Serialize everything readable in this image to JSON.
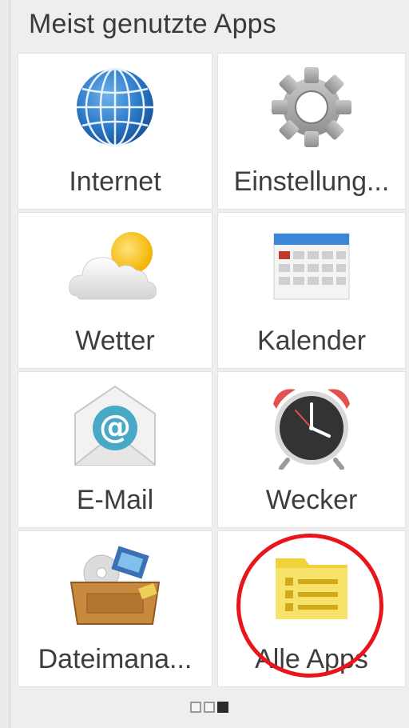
{
  "header": {
    "title": "Meist genutzte Apps"
  },
  "apps": [
    {
      "label": "Internet",
      "icon": "globe-icon"
    },
    {
      "label": "Einstellung...",
      "icon": "gear-icon"
    },
    {
      "label": "Wetter",
      "icon": "weather-cloud-sun-icon"
    },
    {
      "label": "Kalender",
      "icon": "calendar-icon"
    },
    {
      "label": "E-Mail",
      "icon": "email-envelope-icon"
    },
    {
      "label": "Wecker",
      "icon": "alarm-clock-icon"
    },
    {
      "label": "Dateimana...",
      "icon": "file-manager-box-icon"
    },
    {
      "label": "Alle Apps",
      "icon": "all-apps-folder-icon"
    }
  ],
  "pager": {
    "pages": 3,
    "active_index": 2
  },
  "annotation": {
    "highlighted_app": "Alle Apps",
    "color": "#e8151b"
  }
}
